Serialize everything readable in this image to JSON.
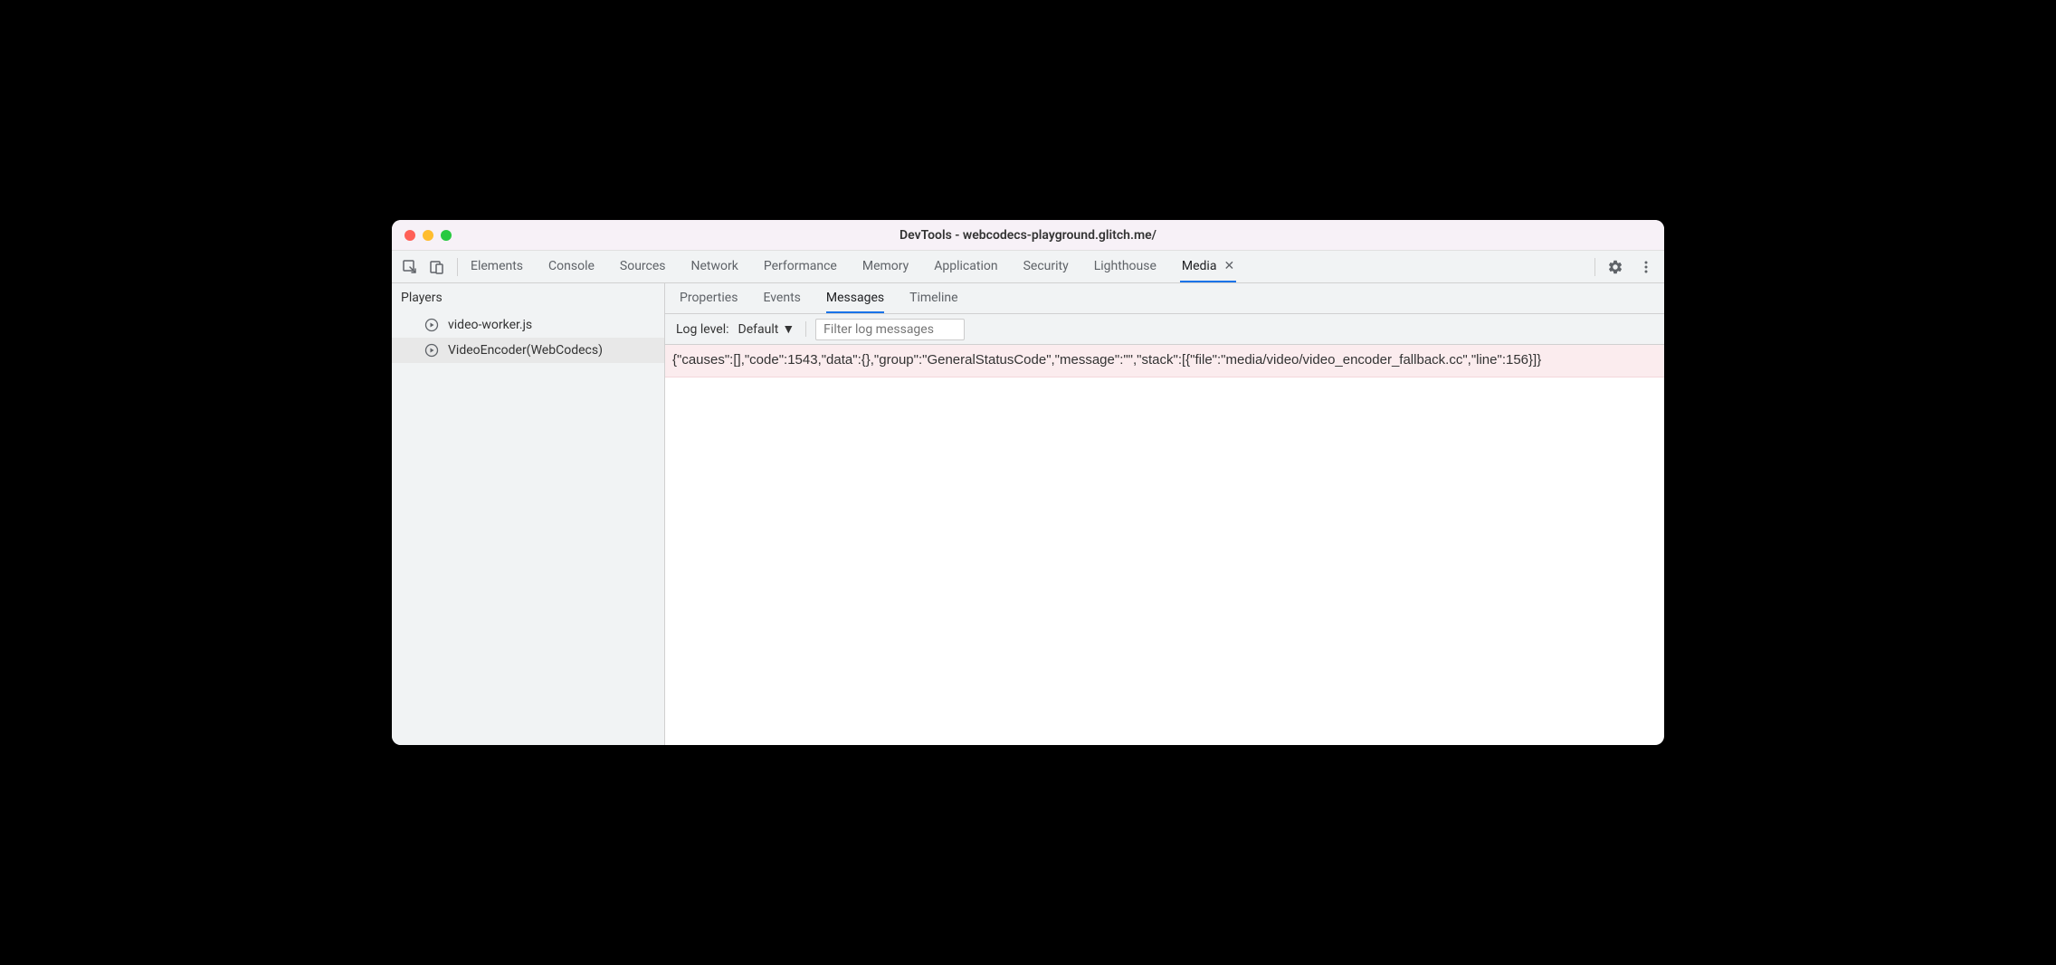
{
  "window": {
    "title": "DevTools - webcodecs-playground.glitch.me/"
  },
  "tabs": {
    "items": [
      "Elements",
      "Console",
      "Sources",
      "Network",
      "Performance",
      "Memory",
      "Application",
      "Security",
      "Lighthouse",
      "Media"
    ],
    "active": "Media"
  },
  "sidebar": {
    "header": "Players",
    "players": [
      {
        "label": "video-worker.js",
        "selected": false
      },
      {
        "label": "VideoEncoder(WebCodecs)",
        "selected": true
      }
    ]
  },
  "subtabs": {
    "items": [
      "Properties",
      "Events",
      "Messages",
      "Timeline"
    ],
    "active": "Messages"
  },
  "filter": {
    "label": "Log level:",
    "select_value": "Default",
    "placeholder": "Filter log messages"
  },
  "messages": [
    "{\"causes\":[],\"code\":1543,\"data\":{},\"group\":\"GeneralStatusCode\",\"message\":\"\",\"stack\":[{\"file\":\"media/video/video_encoder_fallback.cc\",\"line\":156}]}"
  ]
}
